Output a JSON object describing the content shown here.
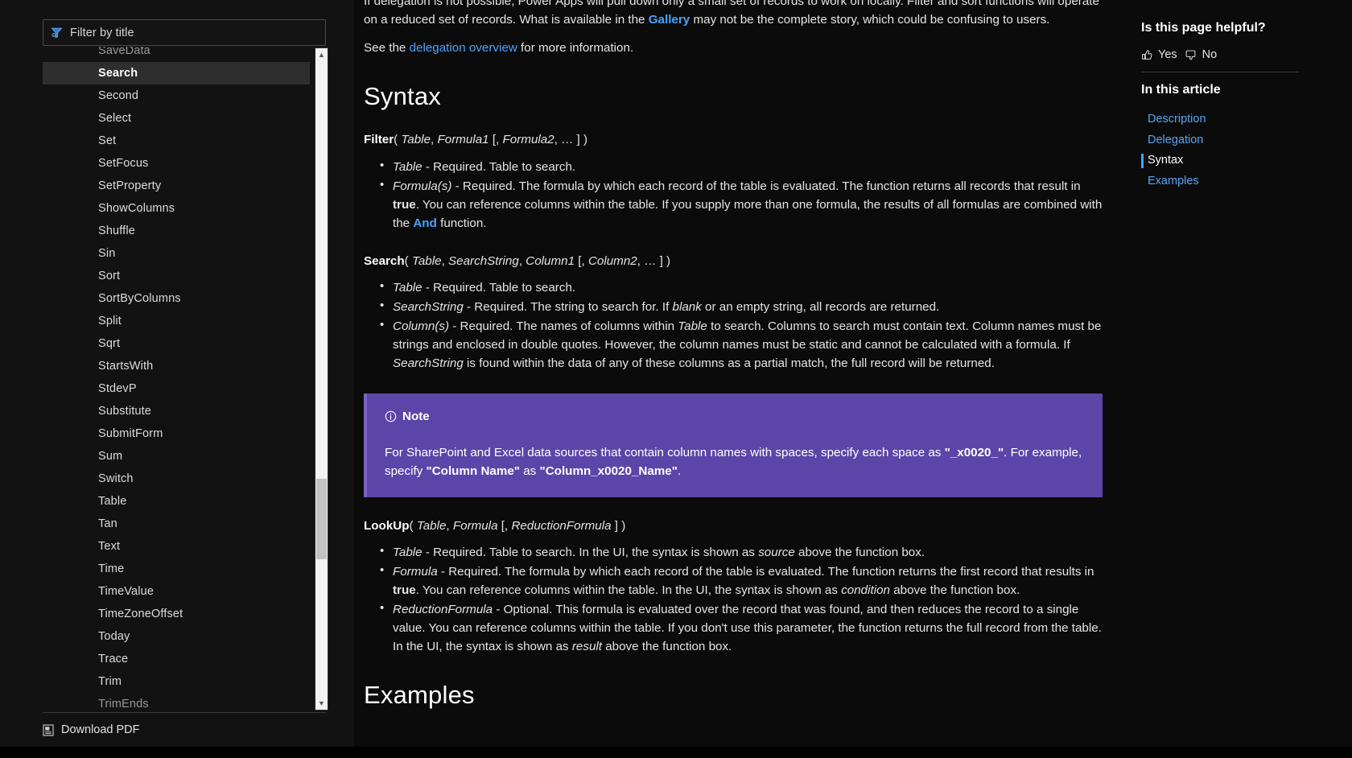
{
  "sidebar": {
    "filter": {
      "placeholder": "Filter by title",
      "icon": "filter-icon"
    },
    "items": [
      {
        "label": "SaveData",
        "state": "clipped"
      },
      {
        "label": "Search",
        "state": "selected"
      },
      {
        "label": "Second",
        "state": "normal"
      },
      {
        "label": "Select",
        "state": "normal"
      },
      {
        "label": "Set",
        "state": "normal"
      },
      {
        "label": "SetFocus",
        "state": "normal"
      },
      {
        "label": "SetProperty",
        "state": "normal"
      },
      {
        "label": "ShowColumns",
        "state": "normal"
      },
      {
        "label": "Shuffle",
        "state": "normal"
      },
      {
        "label": "Sin",
        "state": "normal"
      },
      {
        "label": "Sort",
        "state": "normal"
      },
      {
        "label": "SortByColumns",
        "state": "normal"
      },
      {
        "label": "Split",
        "state": "normal"
      },
      {
        "label": "Sqrt",
        "state": "normal"
      },
      {
        "label": "StartsWith",
        "state": "normal"
      },
      {
        "label": "StdevP",
        "state": "normal"
      },
      {
        "label": "Substitute",
        "state": "normal"
      },
      {
        "label": "SubmitForm",
        "state": "normal"
      },
      {
        "label": "Sum",
        "state": "normal"
      },
      {
        "label": "Switch",
        "state": "normal"
      },
      {
        "label": "Table",
        "state": "normal"
      },
      {
        "label": "Tan",
        "state": "normal"
      },
      {
        "label": "Text",
        "state": "normal"
      },
      {
        "label": "Time",
        "state": "normal"
      },
      {
        "label": "TimeValue",
        "state": "normal"
      },
      {
        "label": "TimeZoneOffset",
        "state": "normal"
      },
      {
        "label": "Today",
        "state": "normal"
      },
      {
        "label": "Trace",
        "state": "normal"
      },
      {
        "label": "Trim",
        "state": "normal"
      },
      {
        "label": "TrimEnds",
        "state": "clipped"
      }
    ],
    "download_pdf": {
      "label": "Download PDF",
      "icon": "pdf-document-icon"
    },
    "scrollbar": {
      "up_arrow": "▲",
      "down_arrow": "▼"
    }
  },
  "main": {
    "intro_paragraph": {
      "part1": "If delegation is not possible, Power Apps will pull down only a small set of records to work on locally. Filter and sort functions will operate on a reduced set of records. What is available in the ",
      "link": "Gallery",
      "part2": " may not be the complete story, which could be confusing to users."
    },
    "see_also": {
      "part1": "See the ",
      "link": "delegation overview",
      "part2": " for more information."
    },
    "syntax_heading": "Syntax",
    "filter_signature": {
      "name": "Filter",
      "open": "( ",
      "arg1": "Table",
      "sep1": ", ",
      "arg2": "Formula1",
      "optional": " [, ",
      "arg3": "Formula2",
      "tail": ", … ] )"
    },
    "filter_args": [
      {
        "term": "Table",
        "text": " - Required. Table to search."
      },
      {
        "term": "Formula(s)",
        "text": " - Required. The formula by which each record of the table is evaluated. The function returns all records that result in ",
        "bold1": "true",
        "text2": ". You can reference columns within the table. If you supply more than one formula, the results of all formulas are combined with the ",
        "link": "And",
        "text3": " function."
      }
    ],
    "search_signature": {
      "name": "Search",
      "open": "( ",
      "arg1": "Table",
      "sep1": ", ",
      "arg2": "SearchString",
      "sep2": ", ",
      "arg3": "Column1",
      "optional": " [, ",
      "arg4": "Column2",
      "tail": ", … ] )"
    },
    "search_args": [
      {
        "term": "Table",
        "text": " - Required. Table to search."
      },
      {
        "term": "SearchString",
        "text": " - Required. The string to search for. If ",
        "italic1": "blank",
        "text2": " or an empty string, all records are returned."
      },
      {
        "term": "Column(s)",
        "text": " - Required. The names of columns within ",
        "italic1": "Table",
        "text2": " to search. Columns to search must contain text. Column names must be strings and enclosed in double quotes. However, the column names must be static and cannot be calculated with a formula. If ",
        "italic2": "SearchString",
        "text3": " is found within the data of any of these columns as a partial match, the full record will be returned."
      }
    ],
    "note": {
      "icon": "info-circle-icon",
      "title": "Note",
      "part1": "For SharePoint and Excel data sources that contain column names with spaces, specify each space as ",
      "code1": "\"_x0020_\"",
      "part2": ". For example, specify ",
      "code2": "\"Column Name\"",
      "part3": " as ",
      "code3": "\"Column_x0020_Name\"",
      "part4": "."
    },
    "lookup_signature": {
      "name": "LookUp",
      "open": "( ",
      "arg1": "Table",
      "sep1": ", ",
      "arg2": "Formula",
      "optional": " [, ",
      "arg3": "ReductionFormula",
      "tail": " ] )"
    },
    "lookup_args": [
      {
        "term": "Table",
        "text": " - Required. Table to search. In the UI, the syntax is shown as ",
        "italic1": "source",
        "text2": " above the function box."
      },
      {
        "term": "Formula",
        "text": " - Required. The formula by which each record of the table is evaluated. The function returns the first record that results in ",
        "bold1": "true",
        "text2": ". You can reference columns within the table. In the UI, the syntax is shown as ",
        "italic1": "condition",
        "text3": " above the function box."
      },
      {
        "term": "ReductionFormula",
        "text": " - Optional. This formula is evaluated over the record that was found, and then reduces the record to a single value. You can reference columns within the table. If you don't use this parameter, the function returns the full record from the table. In the UI, the syntax is shown as ",
        "italic1": "result",
        "text2": " above the function box."
      }
    ],
    "examples_heading": "Examples"
  },
  "right_rail": {
    "feedback_title": "Is this page helpful?",
    "yes_label": "Yes",
    "no_label": "No",
    "toc_title": "In this article",
    "toc_items": [
      {
        "label": "Description",
        "active": false
      },
      {
        "label": "Delegation",
        "active": false
      },
      {
        "label": "Syntax",
        "active": true
      },
      {
        "label": "Examples",
        "active": false
      }
    ]
  },
  "colors": {
    "page_background": "#0b0b0b",
    "sidebar_background": "#121212",
    "link": "#4aa3ff",
    "note_background": "#5c45a8",
    "selected_item_background": "#2e2e2e",
    "scrollbar_track": "#f2f2f2",
    "scrollbar_thumb": "#c2c2c2"
  }
}
